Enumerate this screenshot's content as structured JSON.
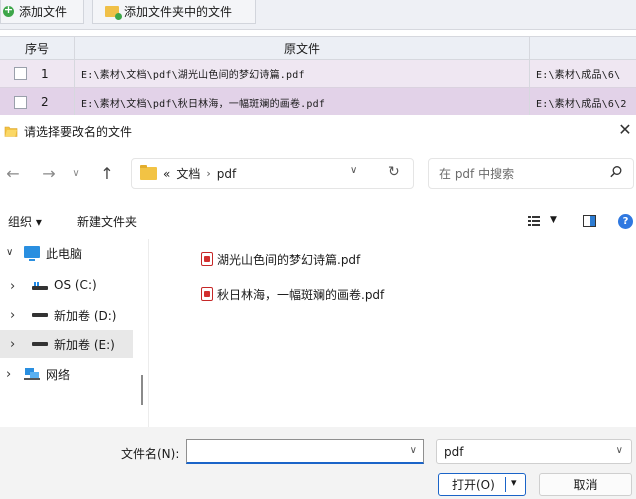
{
  "app": {
    "toolbar": {
      "add_file_label": "添加文件",
      "add_folder_label": "添加文件夹中的文件"
    },
    "table": {
      "headers": {
        "no": "序号",
        "source": "原文件"
      },
      "rows": [
        {
          "no": "1",
          "source": "E:\\素材\\文档\\pdf\\湖光山色间的梦幻诗篇.pdf",
          "output": "E:\\素材\\成品\\6\\"
        },
        {
          "no": "2",
          "source": "E:\\素材\\文档\\pdf\\秋日林海，一幅斑斓的画卷.pdf",
          "output": "E:\\素材\\成品\\6\\2"
        }
      ]
    }
  },
  "dialog": {
    "title": "请选择要改名的文件",
    "close_glyph": "✕",
    "nav": {
      "back_glyph": "←",
      "forward_glyph": "→",
      "recent_glyph": "∨",
      "up_glyph": "↑",
      "address_prefix": "«",
      "breadcrumbs": [
        "文档",
        "pdf"
      ],
      "crumb_sep": "›",
      "address_dropdown_glyph": "∨",
      "refresh_glyph": "↻",
      "search_placeholder": "在 pdf 中搜索"
    },
    "commands": {
      "organize": "组织 ▾",
      "new_folder": "新建文件夹",
      "view_dropdown_glyph": "▼",
      "help_glyph": "?"
    },
    "tree": [
      {
        "label": "此电脑",
        "arrow": "∨",
        "icon": "computer-icon"
      },
      {
        "label": "OS (C:)",
        "arrow": "›",
        "icon": "os-drive-icon"
      },
      {
        "label": "新加卷 (D:)",
        "arrow": "›",
        "icon": "drive-icon"
      },
      {
        "label": "新加卷 (E:)",
        "arrow": "›",
        "icon": "drive-icon",
        "selected": true
      },
      {
        "label": "网络",
        "arrow": "›",
        "icon": "network-icon"
      }
    ],
    "files": [
      {
        "name": "湖光山色间的梦幻诗篇.pdf",
        "icon": "pdf-icon"
      },
      {
        "name": "秋日林海，一幅斑斓的画卷.pdf",
        "icon": "pdf-icon"
      }
    ],
    "footer": {
      "filename_label": "文件名(N):",
      "filename_value": "",
      "filename_dropdown_glyph": "∨",
      "filetype_value": "pdf",
      "filetype_dropdown_glyph": "∨",
      "open_label": "打开(O)",
      "open_dropdown_glyph": "▾",
      "cancel_label": "取消"
    },
    "colors": {
      "accent": "#1a64c8",
      "selected_row": "#e2d2e8",
      "folder": "#f2c344"
    }
  }
}
